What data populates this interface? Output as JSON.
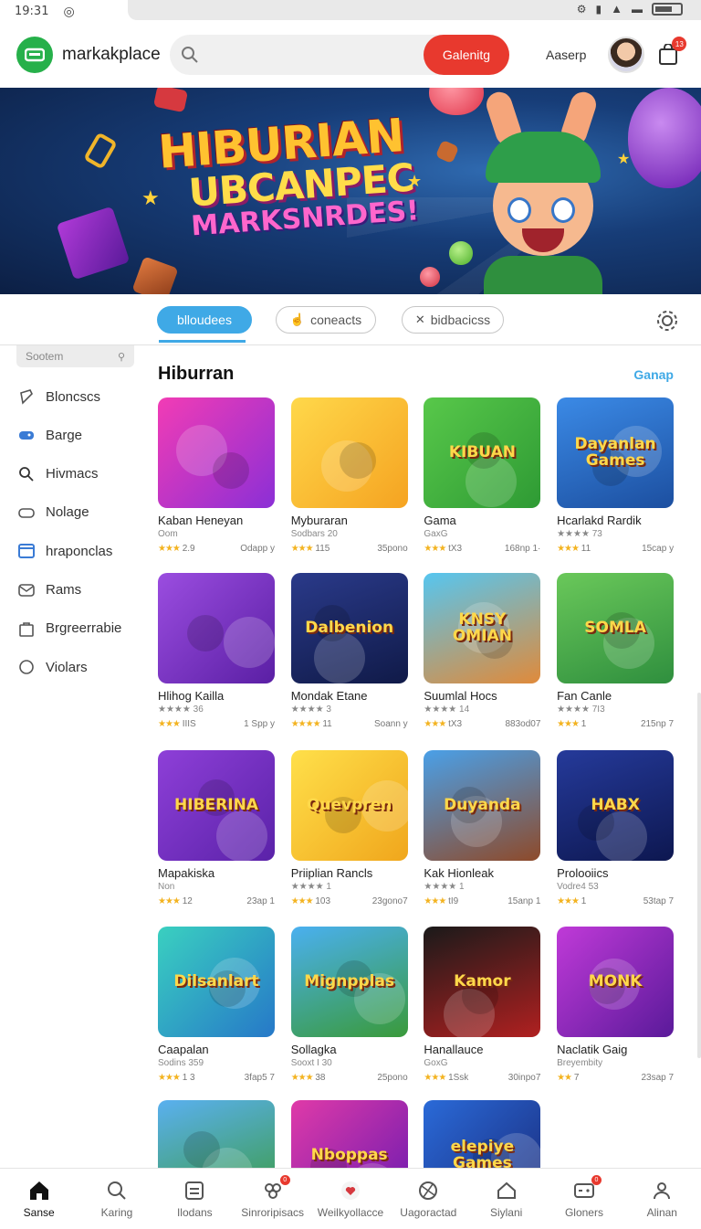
{
  "status": {
    "time": "19:31"
  },
  "header": {
    "app_name": "markakplace",
    "search_placeholder": "",
    "search_button": "Galenitg",
    "user_label": "Aaserp",
    "cart_badge": "13"
  },
  "banner": {
    "line1": "HIBURIAN",
    "line2": "UBCANPEC",
    "line3": "MARKSNRDES!"
  },
  "tabs": [
    {
      "label": "blloudees",
      "active": true
    },
    {
      "label": "coneacts",
      "active": false
    },
    {
      "label": "bidbacicss",
      "active": false
    }
  ],
  "sidebar": {
    "search_placeholder": "Sootem",
    "items": [
      {
        "label": "Bloncscs",
        "icon": "ticket-icon"
      },
      {
        "label": "Barge",
        "icon": "gamepad-icon"
      },
      {
        "label": "Hivmacs",
        "icon": "search-icon"
      },
      {
        "label": "Nolage",
        "icon": "controller-icon"
      },
      {
        "label": "hraponclas",
        "icon": "window-icon"
      },
      {
        "label": "Rams",
        "icon": "mail-icon"
      },
      {
        "label": "Brgreerrabie",
        "icon": "bag-icon"
      },
      {
        "label": "Violars",
        "icon": "circle-icon"
      }
    ]
  },
  "main": {
    "section_title": "Hiburran",
    "section_link": "Ganap",
    "cards": [
      {
        "thumb_text": "",
        "title": "Kaban Heneyan",
        "sub": "Oom",
        "stars": "★★★",
        "rating": "2.9",
        "price": "Odapp y"
      },
      {
        "thumb_text": "",
        "title": "Myburaran",
        "sub": "Sodbars 20",
        "stars": "★★★",
        "rating": "115",
        "price": "35pono"
      },
      {
        "thumb_text": "KIBUAN",
        "title": "Gama",
        "sub": "GaxG",
        "stars": "★★★",
        "rating": "tX3",
        "price": "168np 1·"
      },
      {
        "thumb_text": "Dayanlan Games",
        "title": "Hcarlakd Rardik",
        "sub": "★★★★ 73",
        "stars": "★★★",
        "rating": "11",
        "price": "15cap y"
      },
      {
        "thumb_text": "",
        "title": "Hlihog Kailla",
        "sub": "★★★★ 36",
        "stars": "★★★",
        "rating": "IIIS",
        "price": "1 Spp y"
      },
      {
        "thumb_text": "Dalbenion",
        "title": "Mondak Etane",
        "sub": "★★★★ 3",
        "stars": "★★★★",
        "rating": "11",
        "price": "Soann y"
      },
      {
        "thumb_text": "KNSY OMIAN",
        "title": "Suumlal Hocs",
        "sub": "★★★★ 14",
        "stars": "★★★",
        "rating": "tX3",
        "price": "883od07"
      },
      {
        "thumb_text": "SOMLA",
        "title": "Fan Canle",
        "sub": "★★★★ 7I3",
        "stars": "★★★",
        "rating": "1",
        "price": "215np 7"
      },
      {
        "thumb_text": "HIBERINA",
        "title": "Mapakiska",
        "sub": "Non",
        "stars": "★★★",
        "rating": "12",
        "price": "23ap 1"
      },
      {
        "thumb_text": "Quevpren",
        "title": "Priiplian Rancls",
        "sub": "★★★★ 1",
        "stars": "★★★",
        "rating": "103",
        "price": "23gono7"
      },
      {
        "thumb_text": "Duyanda",
        "title": "Kak Hionleak",
        "sub": "★★★★ 1",
        "stars": "★★★",
        "rating": "tI9",
        "price": "15anp 1"
      },
      {
        "thumb_text": "HABX",
        "title": "Prolooiics",
        "sub": "Vodre4 53",
        "stars": "★★★",
        "rating": "1",
        "price": "53tap 7"
      },
      {
        "thumb_text": "Dilsanlart",
        "title": "Caapalan",
        "sub": "Sodins 359",
        "stars": "★★★",
        "rating": "1 3",
        "price": "3fap5 7"
      },
      {
        "thumb_text": "Mignpplas",
        "title": "Sollagka",
        "sub": "Sooxt I 30",
        "stars": "★★★",
        "rating": "38",
        "price": "25pono"
      },
      {
        "thumb_text": "Kamor",
        "title": "Hanallauce",
        "sub": "GoxG",
        "stars": "★★★",
        "rating": "1Ssk",
        "price": "30inpo7"
      },
      {
        "thumb_text": "MONK",
        "title": "Naclatik Gaig",
        "sub": "Breyembity",
        "stars": "★★",
        "rating": "7",
        "price": "23sap 7"
      },
      {
        "thumb_text": "",
        "title": "",
        "sub": "",
        "stars": "",
        "rating": "",
        "price": ""
      },
      {
        "thumb_text": "Nboppas",
        "title": "",
        "sub": "",
        "stars": "",
        "rating": "",
        "price": ""
      },
      {
        "thumb_text": "elepiye Games",
        "title": "",
        "sub": "",
        "stars": "",
        "rating": "",
        "price": ""
      }
    ]
  },
  "bottom_nav": [
    {
      "label": "Sanse",
      "icon": "home-icon",
      "active": true
    },
    {
      "label": "Karing",
      "icon": "search-icon",
      "active": false
    },
    {
      "label": "Ilodans",
      "icon": "list-icon",
      "active": false
    },
    {
      "label": "Sinroripisacs",
      "icon": "group-icon",
      "active": false,
      "badge": "0"
    },
    {
      "label": "Weilkyollacce",
      "icon": "heart-icon",
      "active": false
    },
    {
      "label": "Uagoractad",
      "icon": "ball-icon",
      "active": false
    },
    {
      "label": "Siylani",
      "icon": "house-icon",
      "active": false
    },
    {
      "label": "Gloners",
      "icon": "gamepad-icon",
      "active": false,
      "badge": "0"
    },
    {
      "label": "Alinan",
      "icon": "user-icon",
      "active": false
    }
  ],
  "colors": {
    "accent": "#3fa9e6",
    "brand": "#26b04a",
    "cta": "#e8392e"
  }
}
